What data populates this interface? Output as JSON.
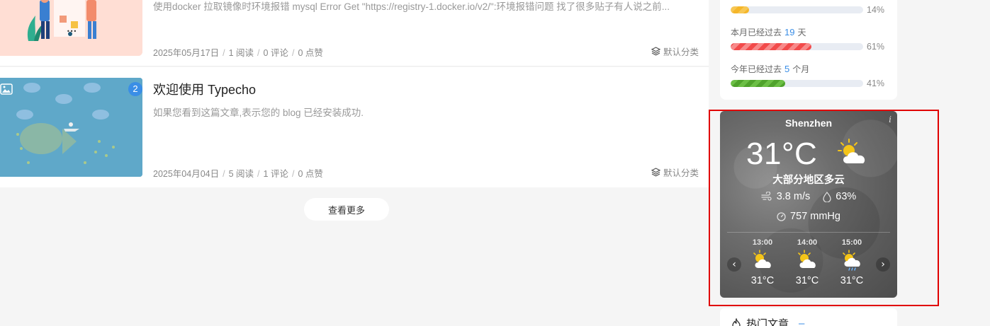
{
  "articles": [
    {
      "excerpt": "使用docker 拉取镜像时环境报错 mysql Error Get \"https://registry-1.docker.io/v2/\":环境报错问题 找了很多贴子有人说之前...",
      "date": "2025年05月17日",
      "reads": "1 阅读",
      "comments": "0 评论",
      "likes": "0 点赞",
      "category": "默认分类"
    },
    {
      "title": "欢迎使用 Typecho",
      "excerpt": "如果您看到这篇文章,表示您的 blog 已经安装成功.",
      "date": "2025年04月04日",
      "reads": "5 阅读",
      "comments": "1 评论",
      "likes": "0 点赞",
      "category": "默认分类",
      "badge": "2"
    }
  ],
  "more_button": "查看更多",
  "progress": [
    {
      "percent_label": "14%",
      "fraction": 0.14,
      "color": "#f5b629"
    },
    {
      "prefix": "本月已经过去",
      "value": "19",
      "unit": "天",
      "percent_label": "61%",
      "fraction": 0.61,
      "color": "#f24a4a"
    },
    {
      "prefix": "今年已经过去",
      "value": "5",
      "unit": "个月",
      "percent_label": "41%",
      "fraction": 0.41,
      "color": "#4fa22b"
    }
  ],
  "weather": {
    "city": "Shenzhen",
    "info_icon": "i",
    "temperature": "31°C",
    "description": "大部分地区多云",
    "wind": "3.8 m/s",
    "humidity": "63%",
    "pressure": "757 mmHg",
    "hourly": [
      {
        "time": "13:00",
        "temp": "31°C",
        "icon": "partly-cloudy-icon"
      },
      {
        "time": "14:00",
        "temp": "31°C",
        "icon": "partly-cloudy-icon"
      },
      {
        "time": "15:00",
        "temp": "31°C",
        "icon": "partly-cloudy-rain-icon"
      }
    ],
    "prev": "‹",
    "next": "›"
  },
  "hot_articles": {
    "title": "热门文章",
    "dash": "–"
  },
  "accent_color": "#3a8ee6"
}
